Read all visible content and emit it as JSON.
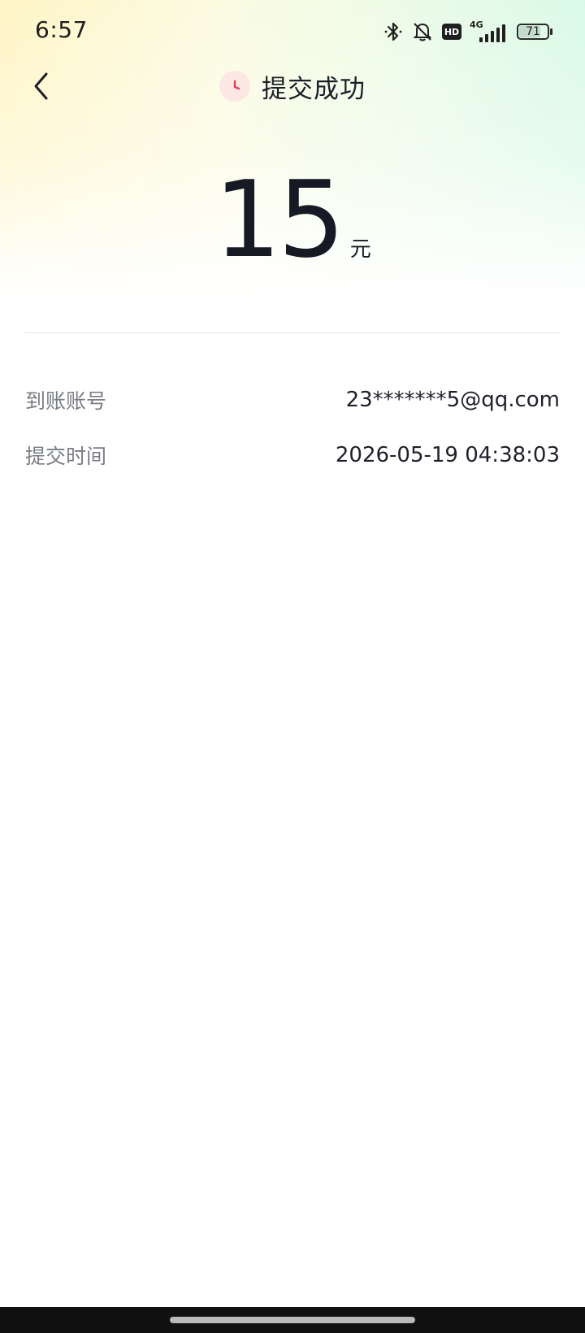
{
  "status_bar": {
    "time": "6:57",
    "hd_label": "HD",
    "network_label": "4G",
    "battery_level": "71",
    "icons": [
      "bluetooth-icon",
      "bell-muted-icon",
      "hd-icon",
      "signal-4g-icon",
      "battery-icon"
    ]
  },
  "header": {
    "title": "提交成功",
    "back_icon": "chevron-left-icon",
    "status_icon": "clock-icon",
    "accent_color": "#e0405a"
  },
  "amount": {
    "value": "15",
    "unit": "元"
  },
  "details": [
    {
      "label": "到账账号",
      "value": "23*******5@qq.com"
    },
    {
      "label": "提交时间",
      "value": "2026-05-19 04:38:03"
    }
  ]
}
